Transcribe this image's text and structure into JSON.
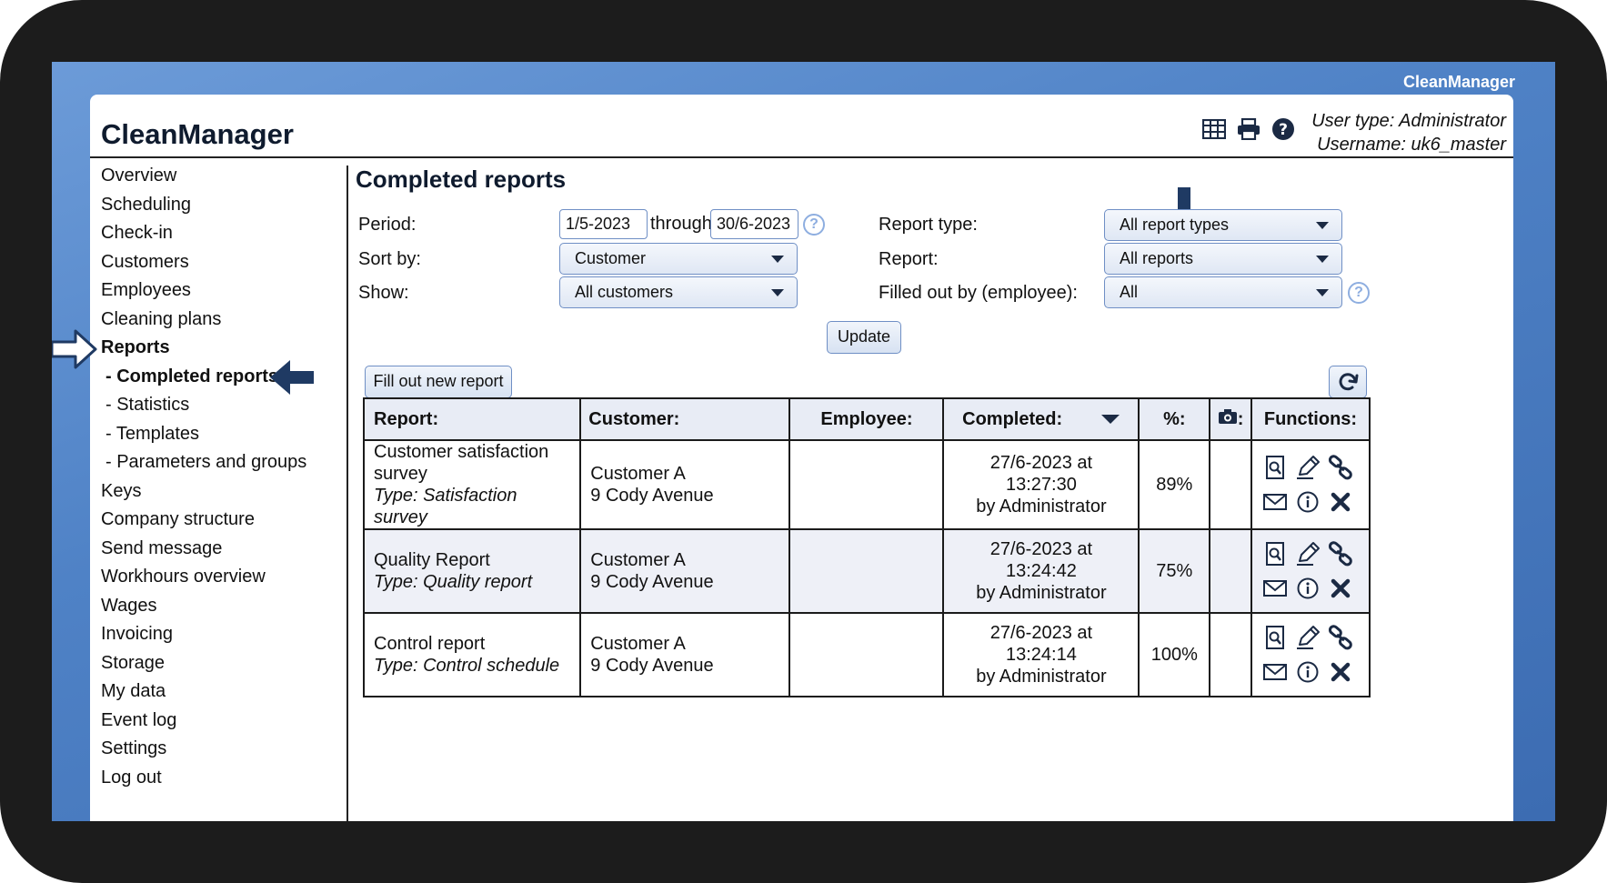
{
  "brand_top": "CleanManager",
  "header": {
    "title": "CleanManager",
    "icons": [
      "table-icon",
      "printer-icon",
      "help-icon"
    ],
    "user_type": "User type: Administrator",
    "username": "Username: uk6_master"
  },
  "sidebar": {
    "items": [
      {
        "label": "Overview"
      },
      {
        "label": "Scheduling"
      },
      {
        "label": "Check-in"
      },
      {
        "label": "Customers"
      },
      {
        "label": "Employees"
      },
      {
        "label": "Cleaning plans"
      },
      {
        "label": "Reports"
      },
      {
        "label": "- Completed reports"
      },
      {
        "label": "- Statistics"
      },
      {
        "label": "- Templates"
      },
      {
        "label": "- Parameters and groups"
      },
      {
        "label": "Keys"
      },
      {
        "label": "Company structure"
      },
      {
        "label": "Send message"
      },
      {
        "label": "Workhours overview"
      },
      {
        "label": "Wages"
      },
      {
        "label": "Invoicing"
      },
      {
        "label": "Storage"
      },
      {
        "label": "My data"
      },
      {
        "label": "Event log"
      },
      {
        "label": "Settings"
      },
      {
        "label": "Log out"
      }
    ]
  },
  "main": {
    "title": "Completed reports",
    "filters": {
      "period_label": "Period:",
      "period_from": "1/5-2023",
      "through_label": "through",
      "period_to": "30/6-2023",
      "sort_label": "Sort by:",
      "sort_value": "Customer",
      "show_label": "Show:",
      "show_value": "All customers",
      "report_type_label": "Report type:",
      "report_type_value": "All report types",
      "report_label": "Report:",
      "report_value": "All reports",
      "filled_label": "Filled out by (employee):",
      "filled_value": "All",
      "help_glyph": "?"
    },
    "update_button": "Update",
    "new_report_button": "Fill out new report",
    "table": {
      "headers": {
        "report": "Report:",
        "customer": "Customer:",
        "employee": "Employee:",
        "completed": "Completed:",
        "percent": "%:",
        "photo_suffix": ":",
        "functions": "Functions:"
      },
      "rows": [
        {
          "report_name_1": "Customer satisfaction",
          "report_name_2": "survey",
          "report_type": "Type: Satisfaction survey",
          "customer": "Customer A",
          "address": "9 Cody Avenue",
          "employee": "",
          "completed": "27/6-2023 at 13:27:30",
          "by": "by Administrator",
          "percent": "89%"
        },
        {
          "report_name_1": "Quality Report",
          "report_name_2": "",
          "report_type": "Type: Quality report",
          "customer": "Customer A",
          "address": "9 Cody Avenue",
          "employee": "",
          "completed": "27/6-2023 at 13:24:42",
          "by": "by Administrator",
          "percent": "75%"
        },
        {
          "report_name_1": "Control report",
          "report_name_2": "",
          "report_type": "Type: Control schedule",
          "customer": "Customer A",
          "address": "9 Cody Avenue",
          "employee": "",
          "completed": "27/6-2023 at 13:24:14",
          "by": "by Administrator",
          "percent": "100%"
        }
      ],
      "function_icons": [
        "view-icon",
        "edit-icon",
        "link-icon",
        "email-icon",
        "info-icon",
        "delete-icon"
      ]
    }
  },
  "colors": {
    "accent_border": "#6f8fc5",
    "arrow": "#1f3a63",
    "background_blue": "#4f82c6"
  }
}
